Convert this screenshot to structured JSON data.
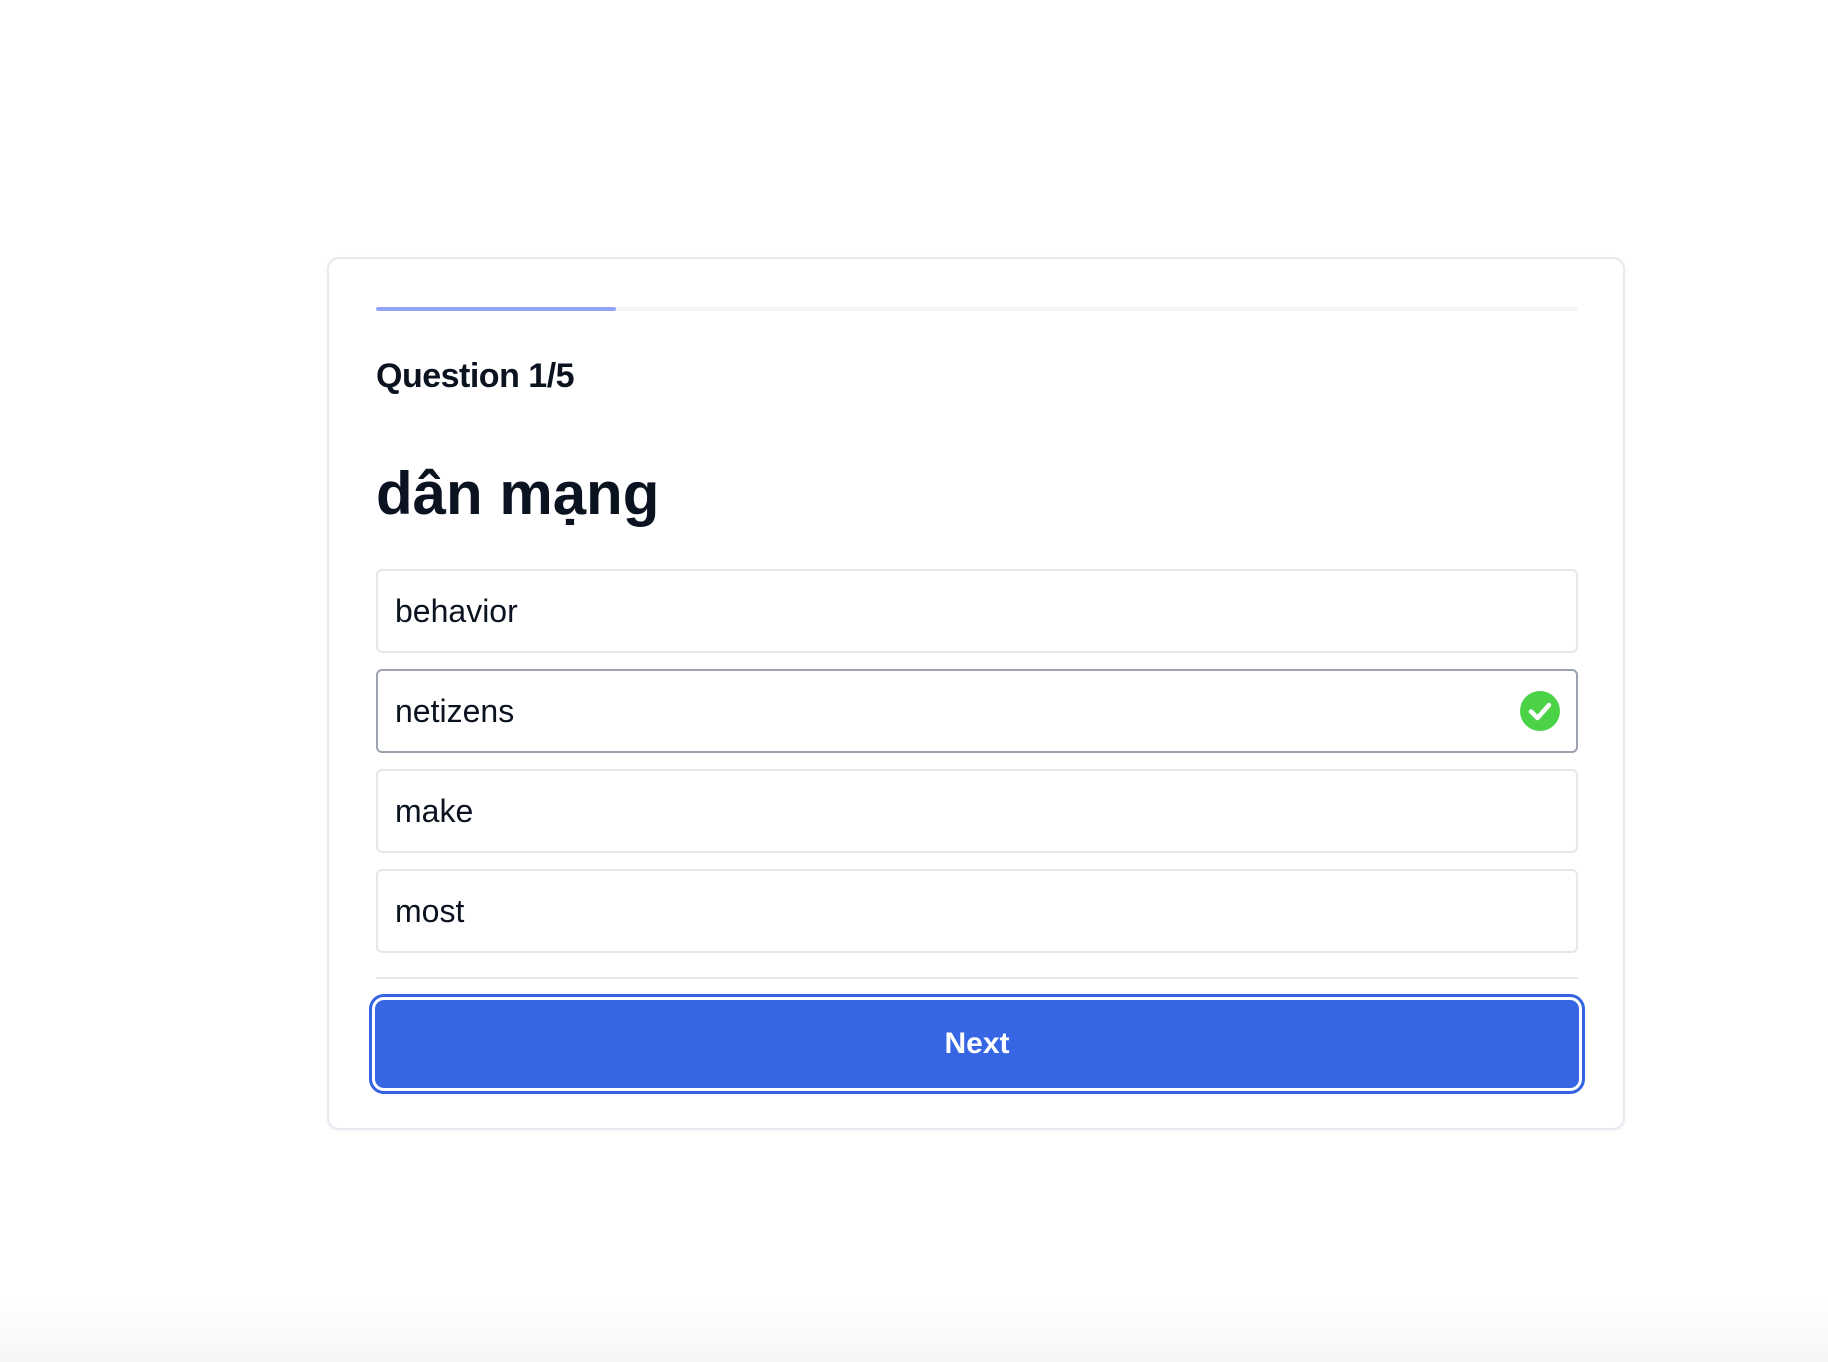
{
  "quiz": {
    "progress_fraction": 0.2,
    "counter": "Question 1/5",
    "word": "dân mạng",
    "options": [
      {
        "label": "behavior",
        "selected": false,
        "correct": false
      },
      {
        "label": "netizens",
        "selected": true,
        "correct": true
      },
      {
        "label": "make",
        "selected": false,
        "correct": false
      },
      {
        "label": "most",
        "selected": false,
        "correct": false
      }
    ],
    "next_label": "Next",
    "correct_icon": "check-circle-icon"
  },
  "colors": {
    "accent": "#3766e4",
    "progress": "#93a3f5",
    "correct": "#4bd247"
  }
}
